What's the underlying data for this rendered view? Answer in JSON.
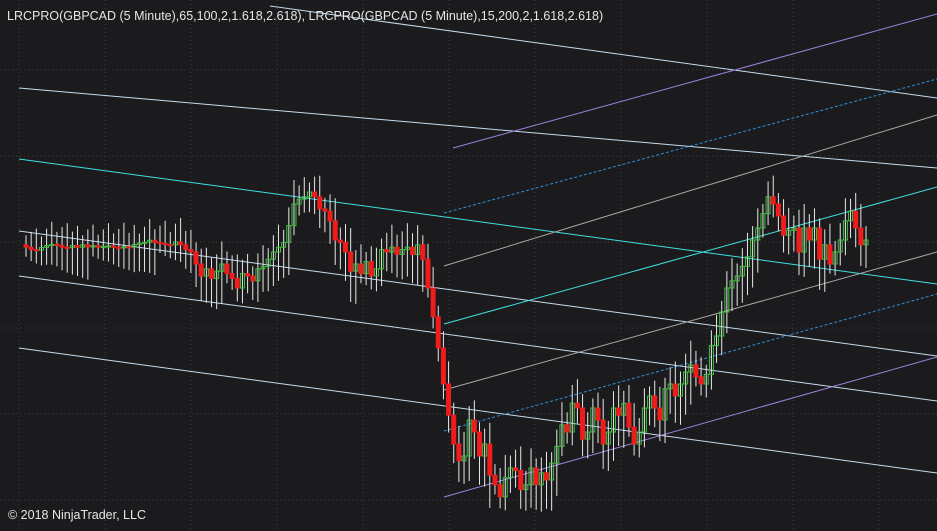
{
  "indicator_label": "LRCPRO(GBPCAD (5 Minute),65,100,2,1.618,2.618), LRCPRO(GBPCAD (5 Minute),15,200,2,1.618,2.618)",
  "copyright": "© 2018 NinjaTrader, LLC",
  "colors": {
    "background": "#1b1b1d",
    "grid": "#3c3c40",
    "up_candle": "#41c241",
    "down_candle": "#ef1c1c",
    "wick": "#e8e8e8",
    "regression_line": "#40e0e0",
    "channel_light": "#c4dcee",
    "channel_gray": "#a8a8a8",
    "channel_dotted": "#2f8fd6",
    "channel_outer": "#9d82e0"
  },
  "chart_data": {
    "type": "candlestick",
    "instrument": "GBPCAD",
    "timeframe": "5 Minute",
    "candle_closes": [
      0.47,
      0.46,
      0.458,
      0.469,
      0.477,
      0.482,
      0.478,
      0.47,
      0.468,
      0.477,
      0.47,
      0.48,
      0.471,
      0.476,
      0.47,
      0.474,
      0.476,
      0.47,
      0.468,
      0.472,
      0.47,
      0.481,
      0.487,
      0.491,
      0.499,
      0.49,
      0.486,
      0.481,
      0.48,
      0.492,
      0.48,
      0.46,
      0.45,
      0.4,
      0.35,
      0.38,
      0.34,
      0.37,
      0.4,
      0.36,
      0.34,
      0.3,
      0.36,
      0.35,
      0.33,
      0.38,
      0.39,
      0.42,
      0.45,
      0.47,
      0.49,
      0.56,
      0.65,
      0.67,
      0.68,
      0.7,
      0.68,
      0.63,
      0.62,
      0.58,
      0.5,
      0.49,
      0.45,
      0.37,
      0.4,
      0.36,
      0.41,
      0.35,
      0.38,
      0.46,
      0.45,
      0.47,
      0.44,
      0.46,
      0.47,
      0.44,
      0.48,
      0.42,
      0.3,
      0.18,
      0.05,
      -0.1,
      -0.23,
      -0.35,
      -0.42,
      -0.4,
      -0.25,
      -0.3,
      -0.4,
      -0.35,
      -0.48,
      -0.52,
      -0.57,
      -0.49,
      -0.45,
      -0.46,
      -0.54,
      -0.52,
      -0.45,
      -0.52,
      -0.47,
      -0.5,
      -0.43,
      -0.36,
      -0.27,
      -0.3,
      -0.18,
      -0.2,
      -0.33,
      -0.3,
      -0.2,
      -0.25,
      -0.35,
      -0.3,
      -0.2,
      -0.23,
      -0.18,
      -0.28,
      -0.35,
      -0.3,
      -0.2,
      -0.15,
      -0.2,
      -0.25,
      -0.12,
      -0.1,
      -0.15,
      -0.1,
      -0.05,
      -0.02,
      -0.07,
      -0.1,
      -0.06,
      0.06,
      0.1,
      0.2,
      0.3,
      0.33,
      0.35,
      0.39,
      0.43,
      0.5,
      0.55,
      0.61,
      0.68,
      0.65,
      0.6,
      0.52,
      0.54,
      0.55,
      0.45,
      0.55,
      0.5,
      0.55,
      0.42,
      0.48,
      0.4,
      0.45,
      0.5,
      0.58,
      0.62,
      0.55,
      0.48,
      0.5
    ],
    "regression_channels": [
      {
        "period": 200,
        "lines": [
          "regression",
          "channel_light",
          "channel_light",
          "channel_light",
          "channel_light",
          "channel_light",
          "channel_outer"
        ]
      },
      {
        "period": 15,
        "lines": [
          "regression",
          "channel_gray",
          "channel_gray",
          "channel_dotted",
          "channel_dotted",
          "channel_outer",
          "channel_outer"
        ]
      }
    ],
    "grid": true,
    "legend": "none"
  }
}
